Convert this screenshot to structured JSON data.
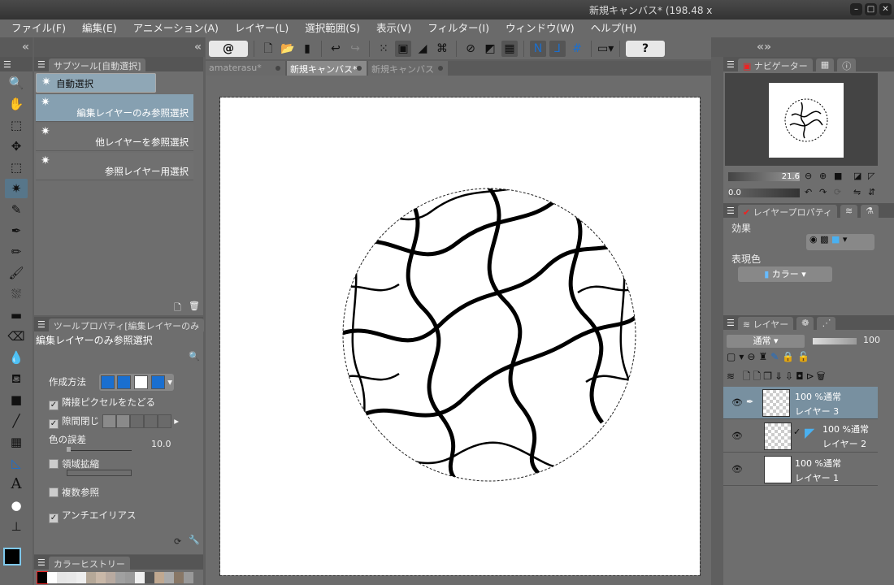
{
  "window": {
    "title": "新規キャンバス* (198.48 x",
    "min": "–",
    "max": "□",
    "close": "✕"
  },
  "menu": [
    "ファイル(F)",
    "編集(E)",
    "アニメーション(A)",
    "レイヤー(L)",
    "選択範囲(S)",
    "表示(V)",
    "フィルター(I)",
    "ウィンドウ(W)",
    "ヘルプ(H)"
  ],
  "toolbar": {
    "help": "?"
  },
  "tabs": [
    {
      "label": "amaterasu*"
    },
    {
      "label": "新規キャンバス*"
    },
    {
      "label": "新規キャンバス"
    }
  ],
  "subtool": {
    "tab": "サブツール[自動選択]",
    "items": [
      "自動選択",
      "編集レイヤーのみ参照選択",
      "他レイヤーを参照選択",
      "参照レイヤー用選択"
    ]
  },
  "toolprop": {
    "tab": "ツールプロパティ[編集レイヤーのみ",
    "name": "編集レイヤーのみ参照選択",
    "method_label": "作成方法",
    "follow_adjacent": "隣接ピクセルをたどる",
    "close_gap": "隙間閉じ",
    "color_tolerance": "色の誤差",
    "color_tolerance_value": "10.0",
    "expand": "領域拡縮",
    "multi_ref": "複数参照",
    "antialias": "アンチエイリアス",
    "checks": {
      "follow_adjacent": true,
      "close_gap": true,
      "expand": false,
      "multi_ref": false,
      "antialias": true
    }
  },
  "colorhistory": {
    "tab": "カラーヒストリー",
    "swatches": [
      "#000000",
      "#ffffff",
      "#e6e6e6",
      "#e8e8e8",
      "#eeeeee",
      "#b5a898",
      "#c9b8a8",
      "#b8aaa0",
      "#a0a0a0",
      "#9a9a9a",
      "#f0f0f0",
      "#555555",
      "#c0a890",
      "#aaaaaa",
      "#887766",
      "#999999"
    ]
  },
  "navigator": {
    "tab": "ナビゲーター",
    "zoom": "21.6",
    "rotation": "0.0"
  },
  "layerprop": {
    "tab": "レイヤープロパティ",
    "effect_label": "効果",
    "color_label": "表現色",
    "color_value": "カラー"
  },
  "layers": {
    "tab": "レイヤー",
    "blend": "通常",
    "opacity": "100",
    "items": [
      {
        "mode": "100 %通常",
        "name": "レイヤー 3",
        "selected": true
      },
      {
        "mode": "100 %通常",
        "name": "レイヤー 2",
        "selected": false
      },
      {
        "mode": "100 %通常",
        "name": "レイヤー 1",
        "selected": false
      }
    ]
  },
  "colors": {
    "accent": "#57768a",
    "selection": "#86a0b1",
    "blue": "#1a6fd0"
  }
}
